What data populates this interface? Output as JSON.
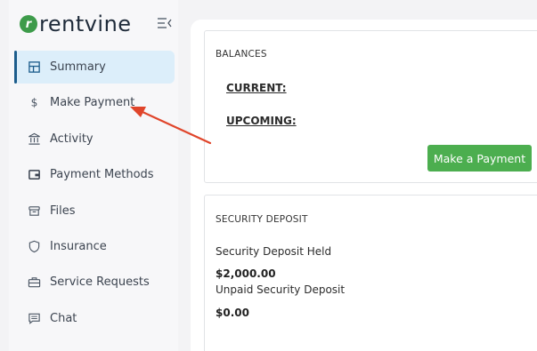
{
  "brand": {
    "name": "rentvine",
    "mark": "r"
  },
  "sidebar": {
    "items": [
      {
        "label": "Summary",
        "icon": "layout-icon",
        "active": true
      },
      {
        "label": "Make Payment",
        "icon": "dollar-icon",
        "active": false
      },
      {
        "label": "Activity",
        "icon": "bank-icon",
        "active": false
      },
      {
        "label": "Payment Methods",
        "icon": "wallet-icon",
        "active": false
      },
      {
        "label": "Files",
        "icon": "archive-icon",
        "active": false
      },
      {
        "label": "Insurance",
        "icon": "shield-icon",
        "active": false
      },
      {
        "label": "Service Requests",
        "icon": "briefcase-icon",
        "active": false
      },
      {
        "label": "Chat",
        "icon": "chat-icon",
        "active": false
      }
    ]
  },
  "balances": {
    "title": "BALANCES",
    "current_label": "CURRENT:",
    "upcoming_label": "UPCOMING:",
    "pay_button": "Make a Payment"
  },
  "deposit": {
    "title": "SECURITY DEPOSIT",
    "held_label": "Security Deposit Held",
    "held_amount": "$2,000.00",
    "unpaid_label": "Unpaid Security Deposit",
    "unpaid_amount": "$0.00"
  },
  "colors": {
    "brand_green": "#3d9b4a",
    "button_green": "#4cae4f",
    "active_bg": "#dceefa",
    "active_bar": "#1c5d8c",
    "arrow_red": "#e0452b"
  }
}
